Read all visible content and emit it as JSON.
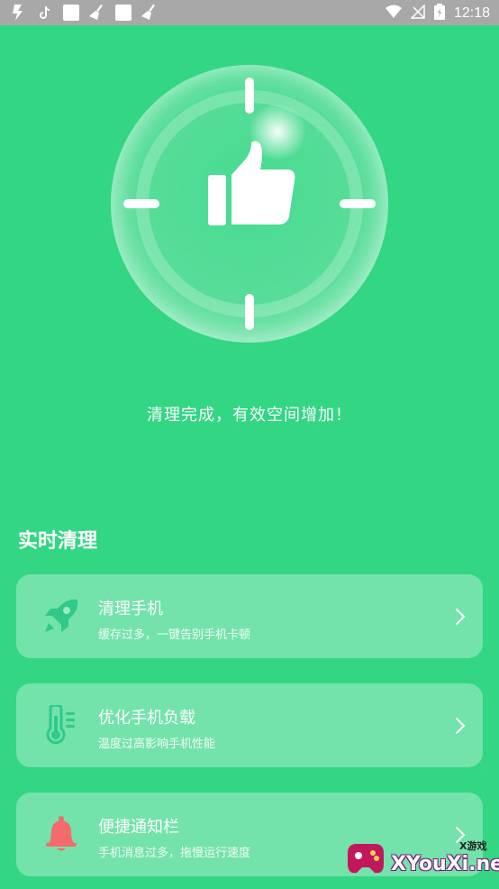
{
  "status_bar": {
    "time": "12:18",
    "left_icons": [
      "flash-icon",
      "tiktok-icon",
      "square-icon",
      "broom-icon",
      "square-icon",
      "broom-icon"
    ],
    "right_icons": [
      "wifi-icon",
      "no-signal-icon",
      "battery-icon"
    ]
  },
  "hero": {
    "message": "清理完成，有效空间增加！"
  },
  "section": {
    "title": "实时清理"
  },
  "cards": [
    {
      "title": "清理手机",
      "subtitle": "缓存过多，一键告别手机卡顿",
      "icon": "rocket-icon",
      "icon_color": "#2fc98a"
    },
    {
      "title": "优化手机负载",
      "subtitle": "温度过高影响手机性能",
      "icon": "thermometer-icon",
      "icon_color": "#2fc98a"
    },
    {
      "title": "便捷通知栏",
      "subtitle": "手机消息过多，拖慢运行速度",
      "icon": "bell-icon",
      "icon_color": "#f36b6b"
    }
  ],
  "watermark": {
    "text": "XYouXi.net",
    "small_text": "X游戏"
  },
  "colors": {
    "background": "#33d683",
    "status_bar": "#a8a8a8"
  }
}
